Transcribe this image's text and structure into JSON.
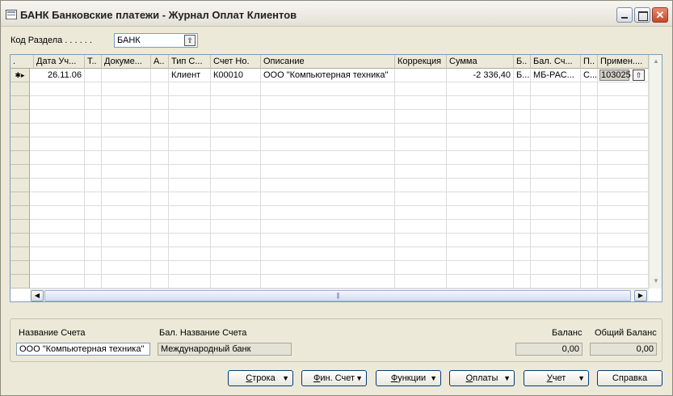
{
  "window": {
    "title": "БАНК Банковские платежи - Журнал Оплат Клиентов",
    "minimize_glyph": "",
    "maximize_glyph": "",
    "close_glyph": "✕"
  },
  "section": {
    "label": "Код Раздела . . . . . .",
    "value": "БАНК",
    "lookup_glyph": "⇧"
  },
  "grid": {
    "columns": [
      {
        "label": "."
      },
      {
        "label": "Дата Уч..."
      },
      {
        "label": "Т.."
      },
      {
        "label": "Докуме..."
      },
      {
        "label": "А.."
      },
      {
        "label": "Тип С..."
      },
      {
        "label": "Счет Но."
      },
      {
        "label": "Описание"
      },
      {
        "label": "Коррекция"
      },
      {
        "label": "Сумма"
      },
      {
        "label": "Б.."
      },
      {
        "label": "Бал. Сч..."
      },
      {
        "label": "П.."
      },
      {
        "label": "Примен...."
      }
    ],
    "row_marker": "✱▸",
    "rows": [
      {
        "date": "26.11.06",
        "type": "",
        "document": "",
        "a": "",
        "account_type": "Клиент",
        "account_no": "К00010",
        "description": "ООО \"Компьютерная техника\"",
        "correction": "",
        "amount": "-2 336,40",
        "b": "Б...",
        "bal_account": "МБ-РАС...",
        "p": "С...",
        "applied": "103025",
        "applied_lookup_glyph": "⇧"
      }
    ],
    "empty_rows": 15
  },
  "scroll": {
    "up": "▲",
    "down": "▼",
    "left": "◀",
    "right": "▶",
    "grip": "|||"
  },
  "info": {
    "account_name_label": "Название Счета",
    "account_name_value": "ООО \"Компьютерная техника\"",
    "bal_account_name_label": "Бал. Название Счета",
    "bal_account_name_value": "Международный банк",
    "balance_label": "Баланс",
    "balance_value": "0,00",
    "total_balance_label": "Общий Баланс",
    "total_balance_value": "0,00"
  },
  "buttons": {
    "line": {
      "hot": "С",
      "rest": "трока"
    },
    "fin_account": {
      "hot": "Ф",
      "rest": "ин. Счет"
    },
    "functions": {
      "hot": "Ф",
      "rest": "ункции"
    },
    "payments": {
      "hot": "О",
      "rest": "платы"
    },
    "posting": {
      "hot": "У",
      "rest": "чет"
    },
    "help": "Справка",
    "dropdown_glyph": "▼"
  }
}
